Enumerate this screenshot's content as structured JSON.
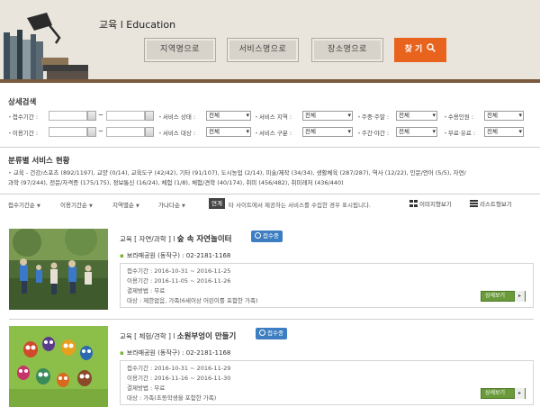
{
  "header": {
    "category_title": "교육 l Education",
    "buttons": [
      "지역명으로",
      "서비스명으로",
      "장소명으로"
    ],
    "find_label": "찾 기"
  },
  "detail_search": {
    "title": "상세검색",
    "receipt_period_label": "접수기간 :",
    "use_period_label": "이용기간 :",
    "tilde": "~",
    "filters_row1": [
      {
        "label": "서비스 상태 :",
        "value": "전체"
      },
      {
        "label": "서비스 지역 :",
        "value": "전체"
      },
      {
        "label": "주중·주말 :",
        "value": "전체"
      },
      {
        "label": "수용인원 :",
        "value": "전체"
      }
    ],
    "filters_row2": [
      {
        "label": "서비스 대상 :",
        "value": "전체"
      },
      {
        "label": "서비스 구분 :",
        "value": "전체"
      },
      {
        "label": "주간·야간 :",
        "value": "전체"
      },
      {
        "label": "무료·유료 :",
        "value": "전체"
      }
    ]
  },
  "categories": {
    "title": "분류별 서비스 현황",
    "line1": "교육 - 건강/스포츠 (892/1197), 교양 (0/14), 교육도구 (42/42), 기타 (91/107), 도시농업 (2/14), 미술/제작 (34/34), 생활체육 (287/287), 역사 (12/22), 인문/언어 (5/5), 자연/",
    "line2": "과학 (97/244), 전문/자격증 (175/175), 정보통신 (16/24), 체험 (1/8), 체험/견학 (40/174), 취미 (456/482), 취미레저 (436/440)"
  },
  "sortbar": {
    "sorts": [
      "접수기간순",
      "이용기간순",
      "지역별순",
      "가나다순"
    ],
    "chip": "연계",
    "notice": "타 사이트에서 제공하는 서비스를 수집한 경우 표시됩니다.",
    "image_view": "이미지형보기",
    "list_view": "리스트형보기"
  },
  "cards": [
    {
      "category": "교육 [ 자연/과학 ] l",
      "name": "숲 속 자연놀이터",
      "status": "접수중",
      "venue": "보라매공원 (동작구) : 02-2181-1168",
      "receipt": "접수기간 : 2016-10-31 ~ 2016-11-25",
      "use": "이용기간 : 2016-11-05 ~ 2016-11-26",
      "payment": "결제방법 : 무료",
      "target": "대상 : 제한없음, 가족(6세이상 어린이를 포함한 가족)",
      "detail": "상세보기"
    },
    {
      "category": "교육 [ 체험/견학 ] l",
      "name": "소원부엉이 만들기",
      "status": "접수중",
      "venue": "보라매공원 (동작구) : 02-2181-1168",
      "receipt": "접수기간 : 2016-10-31 ~ 2016-11-29",
      "use": "이용기간 : 2016-11-16 ~ 2016-11-30",
      "payment": "결제방법 : 무료",
      "target": "대상 : 가족(초등학생을 포함한 가족)",
      "detail": "상세보기"
    }
  ],
  "colors": {
    "accent": "#e8641e",
    "badge": "#3c7ec1",
    "detail_button": "#6a9a3a",
    "header_bg": "#e9e5dd"
  }
}
